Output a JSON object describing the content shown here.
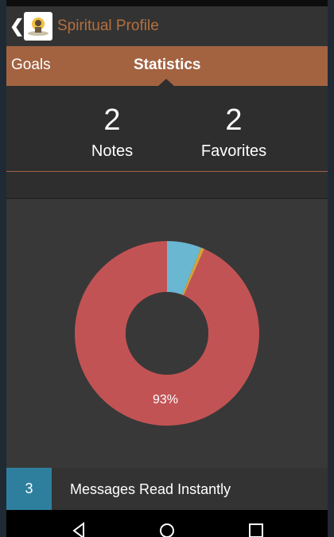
{
  "app_bar": {
    "back_glyph": "❮",
    "title": "Spiritual Profile",
    "logo_icon": "speaker-logo-icon"
  },
  "tabs": [
    {
      "label": "Goals",
      "active": false
    },
    {
      "label": "Statistics",
      "active": true
    }
  ],
  "stats": {
    "notes": {
      "value": "2",
      "label": "Notes"
    },
    "favorites": {
      "value": "2",
      "label": "Favorites"
    }
  },
  "chart_data": {
    "type": "pie",
    "donut": true,
    "slices": [
      {
        "value": 6,
        "color": "#6ab7d1"
      },
      {
        "value": 0.6,
        "color": "#d4a338"
      },
      {
        "value": 93,
        "color": "#c25354"
      }
    ],
    "data_labels": [
      "93%"
    ]
  },
  "footer": {
    "count": "3",
    "label": "Messages Read Instantly"
  },
  "colors": {
    "accent": "#a36341",
    "title": "#b5703f",
    "background": "#2e2e2e",
    "footer_badge": "#2e7f9e"
  },
  "nav": {
    "icons": [
      "back-triangle-icon",
      "home-circle-icon",
      "recents-square-icon"
    ]
  }
}
